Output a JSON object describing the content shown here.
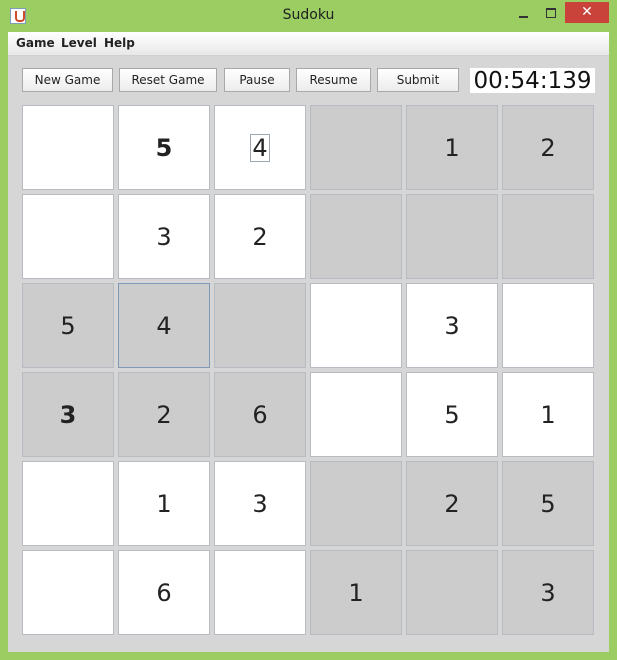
{
  "window": {
    "title": "Sudoku"
  },
  "menu": {
    "items": [
      "Game",
      "Level",
      "Help"
    ]
  },
  "toolbar": {
    "new_game": "New Game",
    "reset_game": "Reset Game",
    "pause": "Pause",
    "resume": "Resume",
    "submit": "Submit"
  },
  "timer": {
    "value": "00:54:139"
  },
  "colors": {
    "frame": "#9bcd63",
    "grey_cell": "#cccccc",
    "close_button": "#c9433a"
  },
  "board": {
    "rows": [
      [
        "",
        "5",
        "4",
        "",
        "1",
        "2"
      ],
      [
        "",
        "3",
        "2",
        "",
        "",
        ""
      ],
      [
        "5",
        "4",
        "",
        "",
        "3",
        ""
      ],
      [
        "3",
        "2",
        "6",
        "",
        "5",
        "1"
      ],
      [
        "",
        "1",
        "3",
        "",
        "2",
        "5"
      ],
      [
        "",
        "6",
        "",
        "1",
        "",
        "3"
      ]
    ]
  }
}
